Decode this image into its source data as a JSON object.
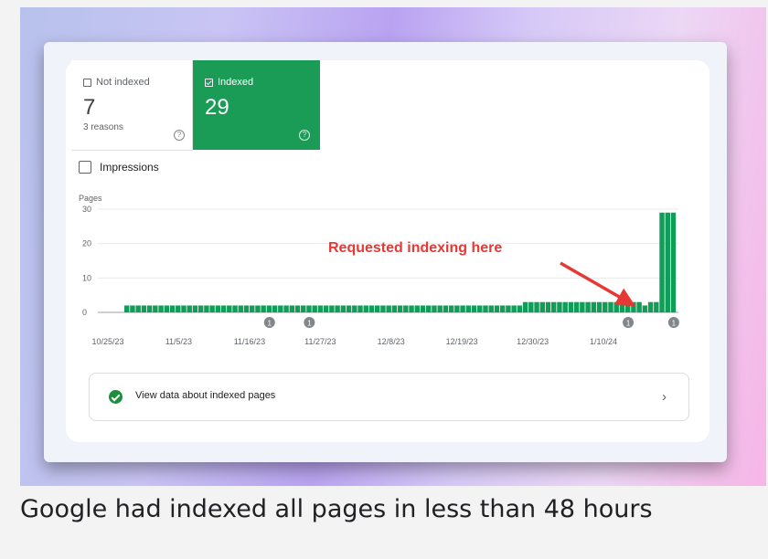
{
  "not_indexed": {
    "label": "Not indexed",
    "value": "7",
    "sub": "3 reasons",
    "help": "?"
  },
  "indexed": {
    "label": "Indexed",
    "value": "29",
    "help": "?"
  },
  "impressions_label": "Impressions",
  "view_row": {
    "label": "View data about indexed pages",
    "chevron": "›"
  },
  "caption": "Google had indexed all pages in less than 48 hours",
  "colors": {
    "bar": "#0f9d58",
    "indexed_bg": "#1a9c57",
    "arrow": "#e53935"
  },
  "chart_data": {
    "type": "bar",
    "ylabel": "Pages",
    "ylim": [
      0,
      30
    ],
    "yticks": [
      "30",
      "20",
      "10",
      "0"
    ],
    "xticks": [
      "10/25/23",
      "11/5/23",
      "11/16/23",
      "11/27/23",
      "12/8/23",
      "12/19/23",
      "12/30/23",
      "1/10/24"
    ],
    "values": [
      2,
      2,
      2,
      2,
      2,
      2,
      2,
      2,
      2,
      2,
      2,
      2,
      2,
      2,
      2,
      2,
      2,
      2,
      2,
      2,
      2,
      2,
      2,
      2,
      2,
      2,
      2,
      2,
      2,
      2,
      2,
      2,
      2,
      2,
      2,
      2,
      2,
      2,
      2,
      2,
      2,
      2,
      2,
      2,
      2,
      2,
      2,
      2,
      2,
      2,
      2,
      2,
      2,
      2,
      2,
      2,
      2,
      2,
      2,
      2,
      2,
      2,
      2,
      2,
      2,
      2,
      2,
      2,
      2,
      2,
      3,
      3,
      3,
      3,
      3,
      3,
      3,
      3,
      3,
      3,
      3,
      3,
      3,
      3,
      3,
      3,
      3,
      3,
      3,
      3,
      3,
      2,
      3,
      3,
      29,
      29,
      29
    ],
    "markers": [
      {
        "index": 25,
        "label": "1"
      },
      {
        "index": 32,
        "label": "1"
      },
      {
        "index": 88,
        "label": "1"
      },
      {
        "index": 96,
        "label": "1"
      }
    ],
    "annotation": "Requested indexing here"
  }
}
